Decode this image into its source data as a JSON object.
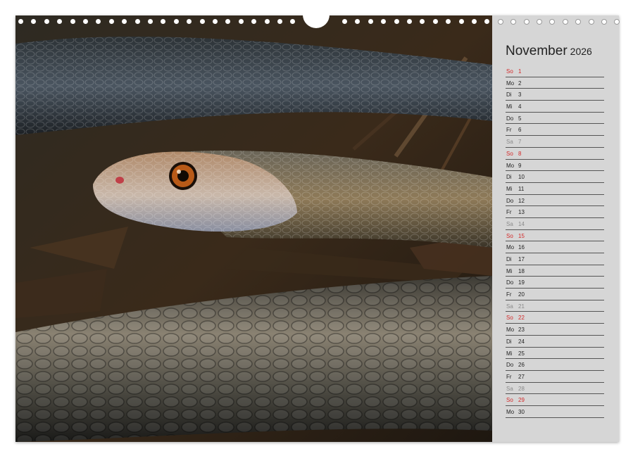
{
  "calendar": {
    "month": "November",
    "year": "2026",
    "days": [
      {
        "wd": "So",
        "d": "1",
        "type": "sun"
      },
      {
        "wd": "Mo",
        "d": "2",
        "type": "week"
      },
      {
        "wd": "Di",
        "d": "3",
        "type": "week"
      },
      {
        "wd": "Mi",
        "d": "4",
        "type": "week"
      },
      {
        "wd": "Do",
        "d": "5",
        "type": "week"
      },
      {
        "wd": "Fr",
        "d": "6",
        "type": "week"
      },
      {
        "wd": "Sa",
        "d": "7",
        "type": "sat"
      },
      {
        "wd": "So",
        "d": "8",
        "type": "sun"
      },
      {
        "wd": "Mo",
        "d": "9",
        "type": "week"
      },
      {
        "wd": "Di",
        "d": "10",
        "type": "week"
      },
      {
        "wd": "Mi",
        "d": "11",
        "type": "week"
      },
      {
        "wd": "Do",
        "d": "12",
        "type": "week"
      },
      {
        "wd": "Fr",
        "d": "13",
        "type": "week"
      },
      {
        "wd": "Sa",
        "d": "14",
        "type": "sat"
      },
      {
        "wd": "So",
        "d": "15",
        "type": "sun"
      },
      {
        "wd": "Mo",
        "d": "16",
        "type": "week"
      },
      {
        "wd": "Di",
        "d": "17",
        "type": "week"
      },
      {
        "wd": "Mi",
        "d": "18",
        "type": "week"
      },
      {
        "wd": "Do",
        "d": "19",
        "type": "week"
      },
      {
        "wd": "Fr",
        "d": "20",
        "type": "week"
      },
      {
        "wd": "Sa",
        "d": "21",
        "type": "sat"
      },
      {
        "wd": "So",
        "d": "22",
        "type": "sun"
      },
      {
        "wd": "Mo",
        "d": "23",
        "type": "week"
      },
      {
        "wd": "Di",
        "d": "24",
        "type": "week"
      },
      {
        "wd": "Mi",
        "d": "25",
        "type": "week"
      },
      {
        "wd": "Do",
        "d": "26",
        "type": "week"
      },
      {
        "wd": "Fr",
        "d": "27",
        "type": "week"
      },
      {
        "wd": "Sa",
        "d": "28",
        "type": "sat"
      },
      {
        "wd": "So",
        "d": "29",
        "type": "sun"
      },
      {
        "wd": "Mo",
        "d": "30",
        "type": "week"
      }
    ]
  },
  "colors": {
    "sunday": "#d42a2a",
    "saturday": "#8a8a8a",
    "panel": "#d6d6d6"
  }
}
